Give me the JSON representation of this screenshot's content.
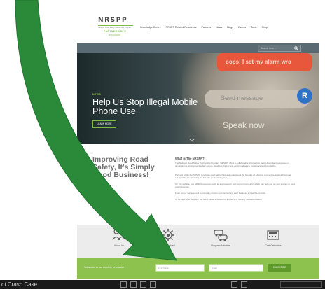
{
  "logo": {
    "main": "NRSPP",
    "tagline": "National Road Safety Partnership Program",
    "sub1": "PARTNERSHIPS",
    "sub2": "PROGRAM"
  },
  "nav": {
    "items": [
      "Knowledge Centre",
      "NRSPP Related Resources",
      "Partners",
      "News",
      "Blogs",
      "Events",
      "Tools",
      "Shop"
    ]
  },
  "search": {
    "placeholder": "Search here..."
  },
  "hero": {
    "badge": "NEWS",
    "title": "Help Us Stop Illegal Mobile Phone Use",
    "button": "LEARN MORE",
    "phone_banner": "oops! I set my alarm wro",
    "phone_input": "Send message",
    "phone_avatar": "R",
    "phone_speak": "Speak now"
  },
  "intro": {
    "title": "Improving Road Safety, It's Simply Good Business!",
    "what_title": "What is The NRSPP?",
    "paragraphs": [
      "The National Road Safety Partnership Program (NRSPP) offers a collaborative approach to assist Australian businesses in developing a positive road safety culture. Its about sharing real-world road safety experience and knowledge.",
      "Partners within the NRSPP recognise road safety risks and understand the benefits of adopting a proactive approach to road safety while also realising the broader productivity gains.",
      "On this website, you will find resources such as key research and support tools, all of which can help you on your journey to road safety success.",
      "From senior management to company drivers and contractors, each business across the network.",
      "To be kept up to date with the latest news, subscribe to the NRSPP monthly newsletter below."
    ]
  },
  "icons_row": [
    {
      "icon": "people-icon",
      "label": "About Us"
    },
    {
      "icon": "gear-icon",
      "label": "Get Involved"
    },
    {
      "icon": "cars-icon",
      "label": "Program Activities"
    },
    {
      "icon": "calculator-icon",
      "label": "Cost Calculator"
    }
  ],
  "newsletter": {
    "label": "Subscribe to our monthly newsletter",
    "first_name_placeholder": "First Name",
    "email_placeholder": "Email",
    "button": "SUBSCRIBE"
  },
  "taskbar": {
    "label": "ot Crash Case"
  },
  "colors": {
    "brand_green": "#8dc24f",
    "arrow_green": "#2a8a3a",
    "strip_gray": "#5a6a72"
  }
}
